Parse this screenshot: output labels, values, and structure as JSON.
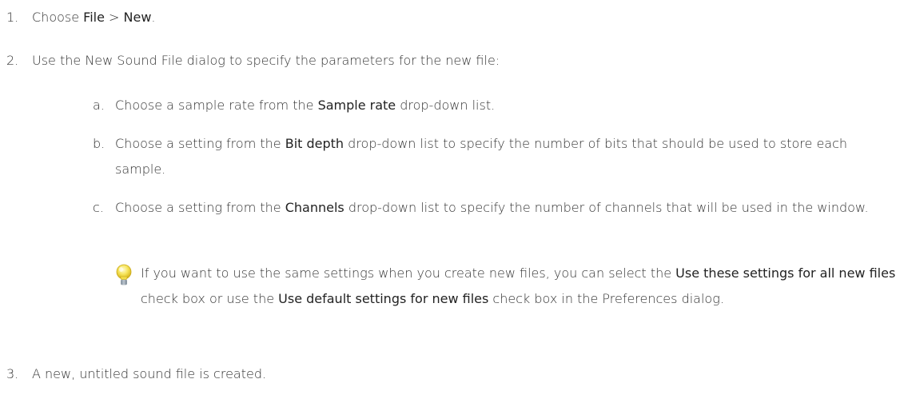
{
  "steps": [
    {
      "num": "1.",
      "parts": [
        "Choose ",
        "File",
        " > ",
        "New",
        "."
      ]
    },
    {
      "num": "2.",
      "text": "Use the New Sound File dialog to specify the parameters for the new file:",
      "substeps": [
        {
          "letter": "a.",
          "pre": "Choose a sample rate from the ",
          "ui": "Sample rate",
          "post": " drop-down list."
        },
        {
          "letter": "b.",
          "pre": "Choose a setting from the ",
          "ui": "Bit depth",
          "post": " drop-down list to specify the number of bits that should be used to store each sample."
        },
        {
          "letter": "c.",
          "pre": "Choose a setting from the ",
          "ui": "Channels",
          "post": " drop-down list to specify the number of channels that will be used in the window."
        }
      ],
      "tip": {
        "icon": "lightbulb-icon",
        "pre": "If you want to use the same settings when you create new files, you can select the ",
        "ui1": "Use these settings for all new files",
        "mid": " check box or use the ",
        "ui2": "Use default settings for new files",
        "post": " check box in the Preferences dialog."
      }
    },
    {
      "num": "3.",
      "text": "A new, untitled sound file is created."
    }
  ]
}
